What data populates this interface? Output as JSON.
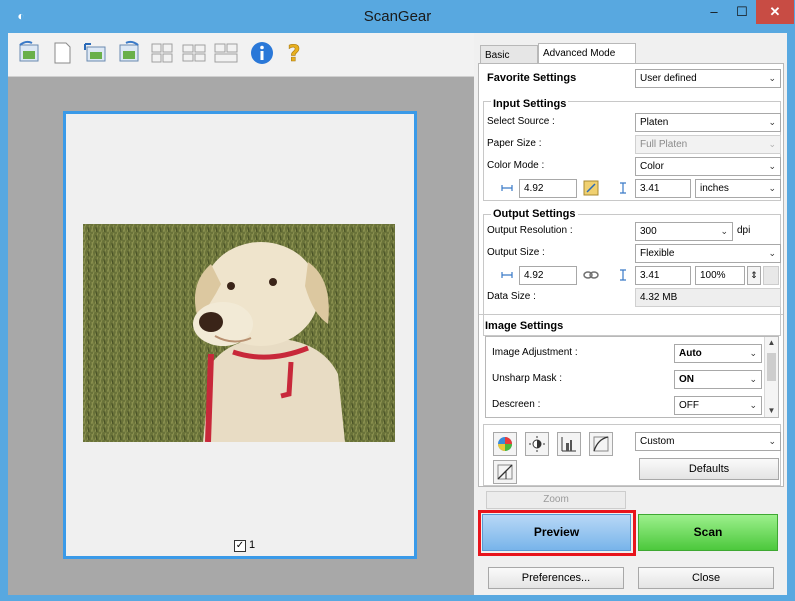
{
  "window": {
    "title": "ScanGear",
    "minimize": "–",
    "maximize": "☐",
    "close": "✕"
  },
  "toolbar": {
    "buttons": [
      "rotate-left-icon",
      "new-page-icon",
      "auto-crop-icon",
      "rotate-right-icon",
      "crop-grid-icon",
      "thumbnail-view-icon",
      "multi-crop-icon",
      "info-icon",
      "help-icon"
    ]
  },
  "preview": {
    "page_number": "1",
    "page_checked": true
  },
  "tabs": {
    "basic": "Basic Mode",
    "advanced": "Advanced Mode"
  },
  "favorite": {
    "label": "Favorite Settings",
    "value": "User defined"
  },
  "input_settings": {
    "heading": "Input Settings",
    "select_source_label": "Select Source :",
    "select_source_value": "Platen",
    "paper_size_label": "Paper Size :",
    "paper_size_value": "Full Platen",
    "color_mode_label": "Color Mode :",
    "color_mode_value": "Color",
    "width": "4.92",
    "height": "3.41",
    "unit": "inches"
  },
  "output_settings": {
    "heading": "Output Settings",
    "resolution_label": "Output Resolution :",
    "resolution_value": "300",
    "resolution_unit": "dpi",
    "size_label": "Output Size :",
    "size_value": "Flexible",
    "width": "4.92",
    "height": "3.41",
    "scale": "100%",
    "data_size_label": "Data Size :",
    "data_size_value": "4.32 MB"
  },
  "image_settings": {
    "heading": "Image Settings",
    "rows": [
      {
        "label": "Image Adjustment :",
        "value": "Auto"
      },
      {
        "label": "Unsharp Mask :",
        "value": "ON"
      },
      {
        "label": "Descreen :",
        "value": "OFF"
      }
    ]
  },
  "adjust": {
    "preset_value": "Custom",
    "defaults_label": "Defaults"
  },
  "buttons": {
    "zoom": "Zoom",
    "preview": "Preview",
    "scan": "Scan",
    "preferences": "Preferences...",
    "close": "Close"
  },
  "colors": {
    "titlebar": "#58a8e0",
    "highlight_border": "#e8141c",
    "scan_green": "#4cc83c",
    "preview_blue": "#78b4ea"
  }
}
